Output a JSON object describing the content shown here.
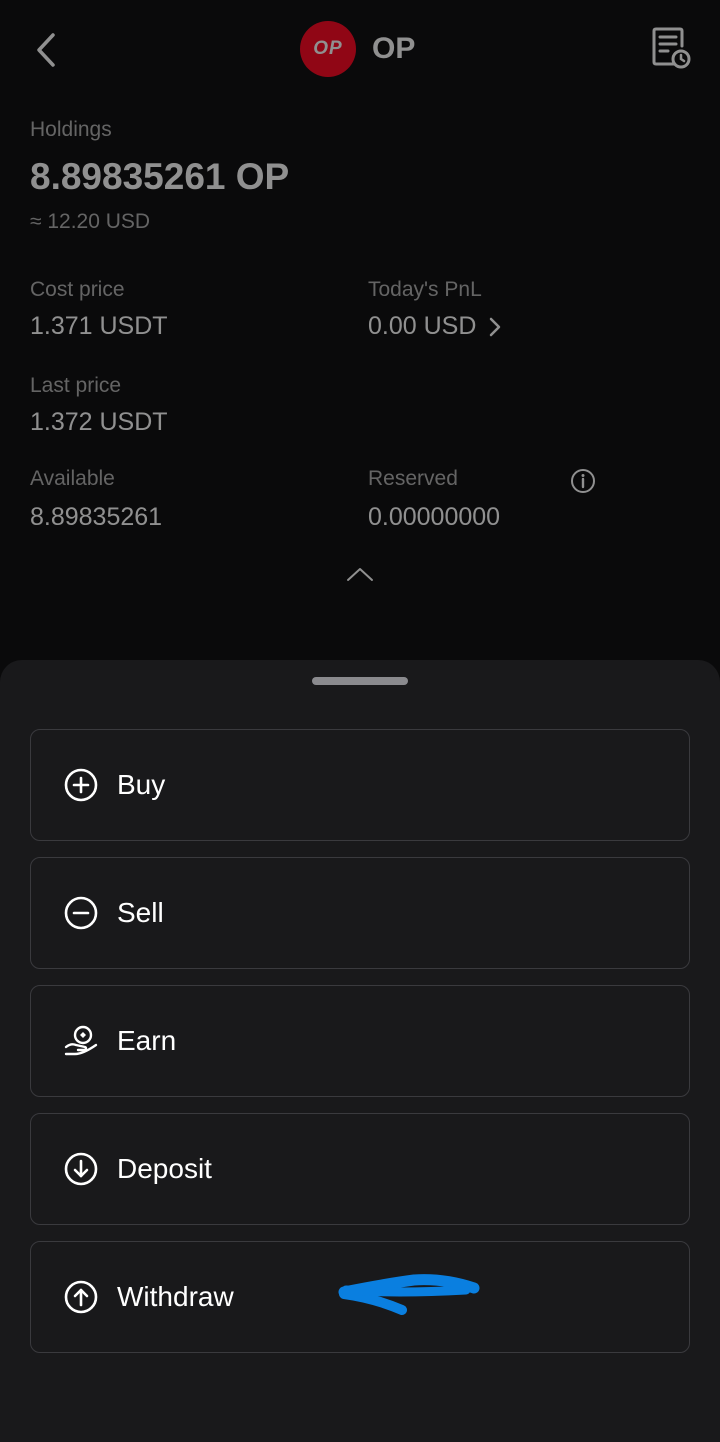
{
  "header": {
    "coin_logo_text": "OP",
    "title": "OP",
    "brand_color": "#ff0420",
    "icons": {
      "back": "chevron-left-icon",
      "history": "document-clock-icon"
    }
  },
  "holdings": {
    "label": "Holdings",
    "amount": "8.89835261 OP",
    "approx_value": "≈ 12.20 USD"
  },
  "stats": {
    "cost_price_label": "Cost price",
    "cost_price_value": "1.371 USDT",
    "todays_pnl_label": "Today's PnL",
    "todays_pnl_value": "0.00 USD",
    "last_price_label": "Last price",
    "last_price_value": "1.372 USDT",
    "available_label": "Available",
    "available_value": "8.89835261",
    "reserved_label": "Reserved",
    "reserved_value": "0.00000000"
  },
  "actions": [
    {
      "label": "Buy",
      "icon": "plus-circle-icon"
    },
    {
      "label": "Sell",
      "icon": "minus-circle-icon"
    },
    {
      "label": "Earn",
      "icon": "hand-coin-icon"
    },
    {
      "label": "Deposit",
      "icon": "arrow-down-circle-icon"
    },
    {
      "label": "Withdraw",
      "icon": "arrow-up-circle-icon"
    }
  ],
  "annotation": {
    "color": "#0a7fe0"
  }
}
